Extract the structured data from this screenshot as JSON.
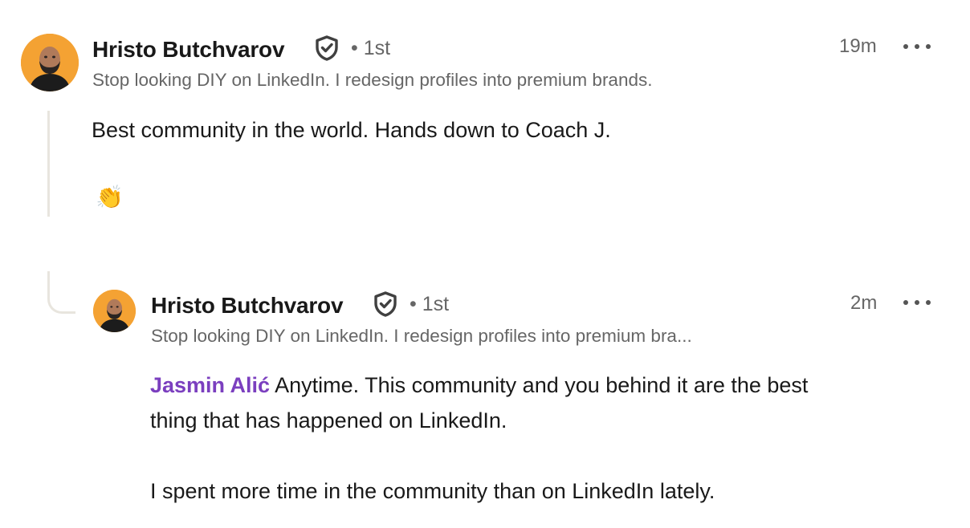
{
  "comment": {
    "author": {
      "name": "Hristo Butchvarov",
      "degree": "• 1st",
      "headline": "Stop looking DIY on LinkedIn. I redesign profiles into premium brands."
    },
    "time": "19m",
    "text": "Best community in the world. Hands down to Coach J.",
    "emoji": "👏"
  },
  "reply": {
    "author": {
      "name": "Hristo Butchvarov",
      "degree": "• 1st",
      "headline": "Stop looking DIY on LinkedIn. I redesign profiles into premium bra..."
    },
    "time": "2m",
    "mention": "Jasmin Alić",
    "text_line1": " Anytime. This community and you behind it are the best",
    "text_line2": "thing that has happened on LinkedIn.",
    "text_line3": "I spent more time in the community than on LinkedIn lately."
  },
  "colors": {
    "accent_mention": "#7b3fbf",
    "avatar_background": "#f4a233",
    "thread_line": "#e8e5de"
  }
}
